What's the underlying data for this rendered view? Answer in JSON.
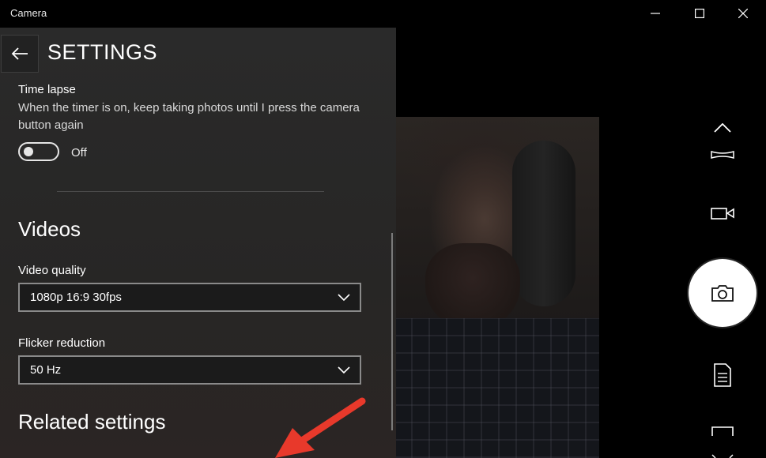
{
  "window": {
    "title": "Camera"
  },
  "settings": {
    "title": "SETTINGS",
    "time_lapse": {
      "label": "Time lapse",
      "description": "When the timer is on, keep taking photos until I press the camera button again",
      "toggle_state": "Off",
      "toggle_on": false
    },
    "videos": {
      "heading": "Videos",
      "video_quality": {
        "label": "Video quality",
        "value": "1080p 16:9 30fps"
      },
      "flicker_reduction": {
        "label": "Flicker reduction",
        "value": "50 Hz"
      }
    },
    "related": {
      "heading": "Related settings"
    }
  },
  "colors": {
    "panel_bg": "#2a2a2a",
    "annotation_arrow": "#e8392b",
    "shutter": "#ffffff"
  },
  "icons": [
    "back-arrow-icon",
    "minimize-icon",
    "maximize-icon",
    "close-icon",
    "chevron-up-icon",
    "panorama-icon",
    "video-icon",
    "camera-icon",
    "document-scan-icon",
    "barcode-icon",
    "chevron-down-icon"
  ]
}
